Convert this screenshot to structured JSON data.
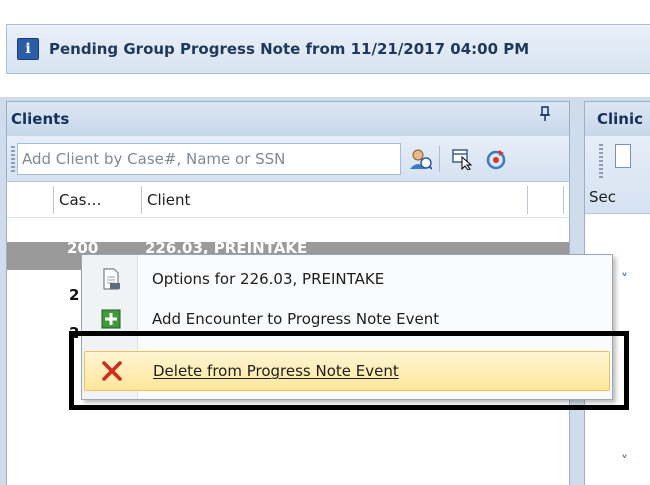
{
  "banner": {
    "title": "Pending Group Progress Note from 11/21/2017 04:00 PM",
    "icon": "info-icon"
  },
  "clients_pane": {
    "title": "Clients",
    "pin_glyph": "ं",
    "search_placeholder": "Add Client by Case#, Name or SSN",
    "toolbar_icons": [
      "add-client-icon",
      "select-cursor-icon",
      "refresh-icon"
    ],
    "columns": [
      "Cas…",
      "Client"
    ],
    "selected_row": {
      "case": "200",
      "client": "226.03, PREINTAKE"
    },
    "row_fragments": [
      "2",
      "2"
    ]
  },
  "clinic_pane": {
    "title": "Clinic",
    "toolbar_label": "Sec"
  },
  "context_menu": {
    "items": [
      {
        "label": "Options for 226.03, PREINTAKE",
        "icon": "document-icon"
      },
      {
        "label": "Add Encounter to Progress Note Event",
        "icon": "add-green-icon"
      },
      {
        "label": "Delete from Progress Note Event",
        "icon": "delete-red-x-icon",
        "highlighted": true,
        "mnemonic": "D"
      }
    ]
  },
  "colors": {
    "accent": "#2b5ea8",
    "header_text": "#15325f",
    "selection_row": "#9a9a9a",
    "menu_highlight": "#ffe79a",
    "highlight_box": "#000000"
  }
}
